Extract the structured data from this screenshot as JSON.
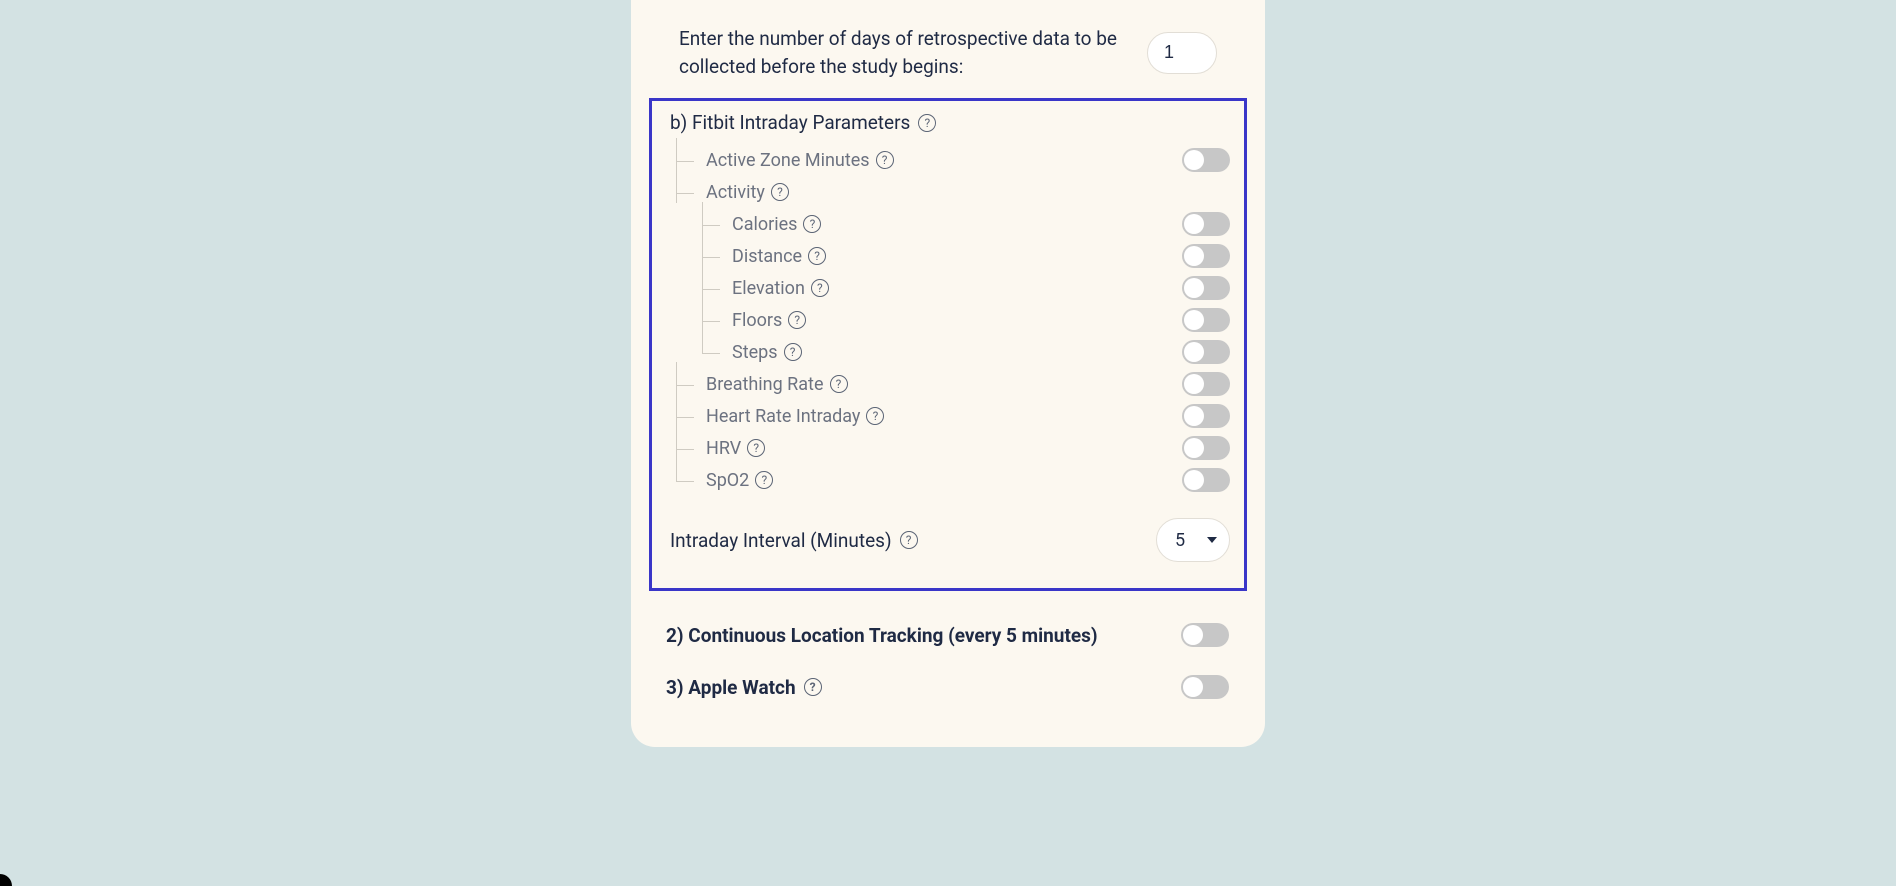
{
  "retro": {
    "label": "Enter the number of days of retrospective data to be collected before the study begins:",
    "value": "1"
  },
  "fitbit_intraday": {
    "title": "b) Fitbit Intraday Parameters",
    "items": {
      "active_zone": "Active Zone Minutes",
      "activity": "Activity",
      "calories": "Calories",
      "distance": "Distance",
      "elevation": "Elevation",
      "floors": "Floors",
      "steps": "Steps",
      "breathing": "Breathing Rate",
      "heart_rate": "Heart Rate Intraday",
      "hrv": "HRV",
      "spo2": "SpO2"
    },
    "interval_label": "Intraday Interval (Minutes)",
    "interval_value": "5"
  },
  "section2": {
    "label": "2) Continuous Location Tracking (every 5 minutes)"
  },
  "section3": {
    "label": "3) Apple Watch"
  }
}
